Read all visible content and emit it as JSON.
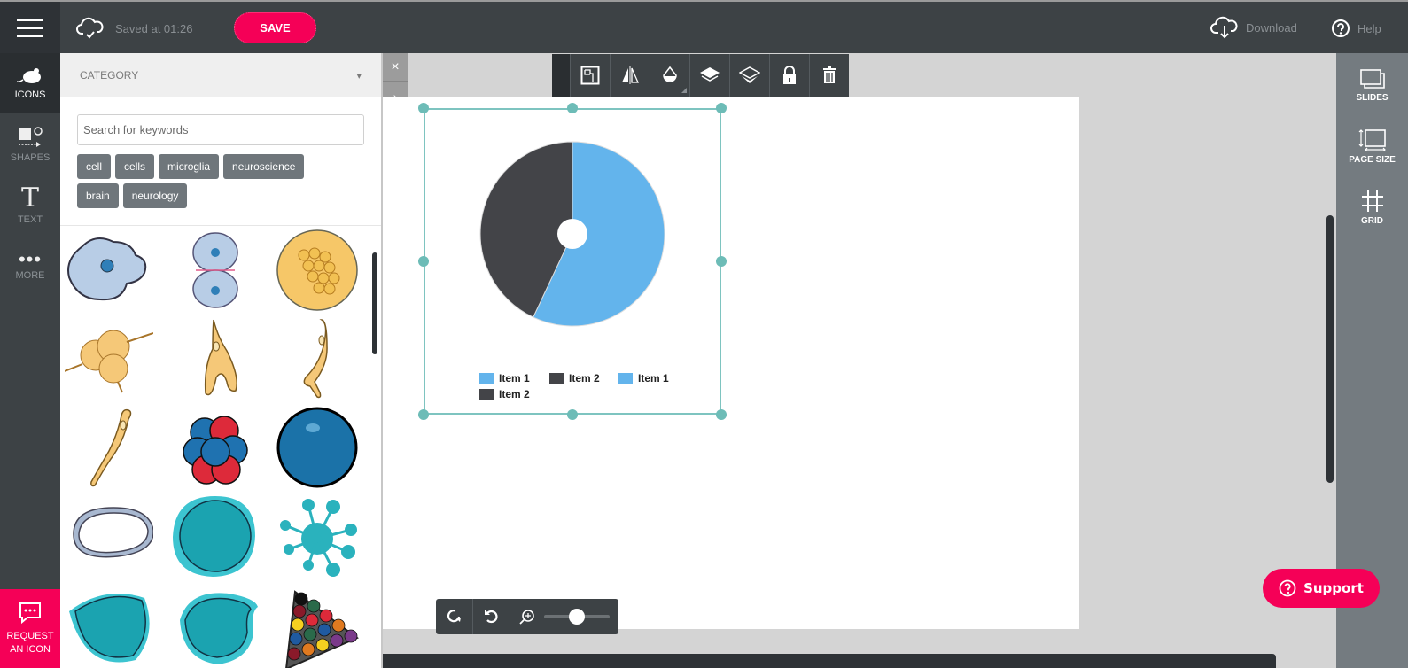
{
  "topbar": {
    "saved_text": "Saved at 01:26",
    "save_label": "SAVE",
    "download_label": "Download",
    "help_label": "Help"
  },
  "leftnav": {
    "items": [
      {
        "label": "ICONS",
        "icon": "mouse-icon",
        "active": true
      },
      {
        "label": "SHAPES",
        "icon": "shapes-icon"
      },
      {
        "label": "TEXT",
        "icon": "text-icon"
      },
      {
        "label": "MORE",
        "icon": "more-icon"
      }
    ],
    "request_line1": "REQUEST",
    "request_line2": "AN ICON"
  },
  "panel": {
    "category_label": "CATEGORY",
    "category_caret": "▾",
    "search_placeholder": "Search for keywords",
    "search_value": "",
    "tags": [
      "cell",
      "cells",
      "microglia",
      "neuroscience",
      "brain",
      "neurology"
    ],
    "icons": [
      "amoeboid-cell",
      "dividing-cell",
      "fat-cell-cluster",
      "microglia-cell",
      "branched-cell",
      "bent-cell",
      "elongated-cell",
      "atomic-nucleus",
      "blue-sphere",
      "ring-cell",
      "teal-round-cell",
      "budding-cell",
      "teal-drop-cell",
      "teal-irregular-cell",
      "billiard-balls-rack"
    ]
  },
  "canvas_controls": {
    "close_glyph": "×",
    "expand_glyph": "›"
  },
  "toolbar": {
    "buttons": [
      "arrange-icon",
      "flip-icon",
      "opacity-icon",
      "bring-forward-icon",
      "send-backward-icon",
      "lock-icon",
      "delete-icon"
    ]
  },
  "zoom": {
    "level_fraction": 0.5
  },
  "rightnav": {
    "items": [
      {
        "label": "SLIDES",
        "icon": "slides-icon"
      },
      {
        "label": "PAGE SIZE",
        "icon": "page-size-icon"
      },
      {
        "label": "GRID",
        "icon": "grid-icon"
      }
    ]
  },
  "support_label": "Support",
  "colors": {
    "accent": "#f50057",
    "series_blue": "#63b4ec",
    "series_dark": "#434448",
    "selection": "#7ec4c0"
  },
  "chart_data": {
    "type": "pie",
    "donut": true,
    "slices": [
      {
        "label": "Item 1",
        "value": 57,
        "color": "#63b4ec"
      },
      {
        "label": "Item 2",
        "value": 43,
        "color": "#434448"
      }
    ],
    "legend": [
      {
        "label": "Item 1",
        "color": "#63b4ec"
      },
      {
        "label": "Item 2",
        "color": "#434448"
      },
      {
        "label": "Item 1",
        "color": "#63b4ec"
      },
      {
        "label": "Item 2",
        "color": "#434448"
      }
    ],
    "legend_position": "bottom",
    "title": ""
  }
}
